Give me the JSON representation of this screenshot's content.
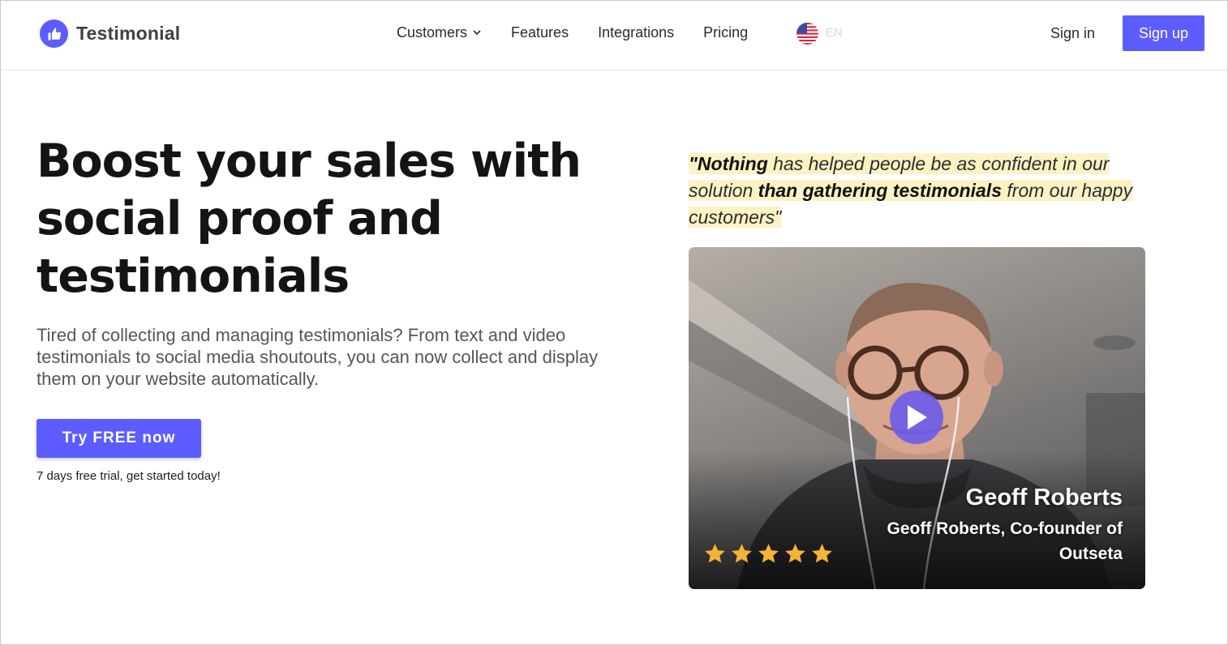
{
  "brand": {
    "name": "Testimonial",
    "accent": "#5d5dff"
  },
  "nav": {
    "items": [
      {
        "label": "Customers",
        "has_dropdown": true
      },
      {
        "label": "Features"
      },
      {
        "label": "Integrations"
      },
      {
        "label": "Pricing"
      }
    ],
    "language": "EN",
    "sign_in": "Sign in",
    "sign_up": "Sign up"
  },
  "hero": {
    "title": "Boost your sales with social proof and testimonials",
    "description": "Tired of collecting and managing testimonials? From text and video testimonials to social media shoutouts, you can now collect and display them on your website automatically.",
    "cta": "Try FREE now",
    "trial_note": "7 days free trial, get started today!"
  },
  "quote": {
    "open": "\"",
    "part1_bold": "Nothing",
    "part2": " has helped people be as confident in our solution ",
    "part3_bold": "than gathering testimonials",
    "part4": " from our happy customers\"",
    "highlight_color": "#fdf2c4"
  },
  "video": {
    "name": "Geoff Roberts",
    "role": "Geoff Roberts, Co-founder of Outseta",
    "rating": 5,
    "star_color": "#f5b335",
    "play_icon": "play-icon"
  }
}
